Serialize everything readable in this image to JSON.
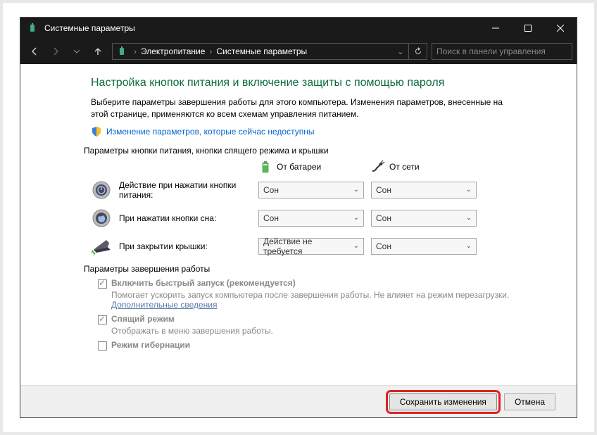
{
  "window": {
    "title": "Системные параметры"
  },
  "nav": {
    "crumb1": "Электропитание",
    "crumb2": "Системные параметры",
    "search_placeholder": "Поиск в панели управления"
  },
  "main": {
    "heading": "Настройка кнопок питания и включение защиты с помощью пароля",
    "desc": "Выберите параметры завершения работы для этого компьютера. Изменения параметров, внесенные на этой странице, применяются ко всем схемам управления питанием.",
    "unlock_link": "Изменение параметров, которые сейчас недоступны",
    "section1": "Параметры кнопки питания, кнопки спящего режима и крышки",
    "col_battery": "От батареи",
    "col_ac": "От сети",
    "rows": [
      {
        "label": "Действие при нажатии кнопки питания:",
        "battery": "Сон",
        "ac": "Сон"
      },
      {
        "label": "При нажатии кнопки сна:",
        "battery": "Сон",
        "ac": "Сон"
      },
      {
        "label": "При закрытии крышки:",
        "battery": "Действие не требуется",
        "ac": "Сон"
      }
    ],
    "section2": "Параметры завершения работы",
    "fastboot": {
      "label": "Включить быстрый запуск (рекомендуется)",
      "sub": "Помогает ускорить запуск компьютера после завершения работы. Не влияет на режим перезагрузки. ",
      "link": "Дополнительные сведения"
    },
    "sleep": {
      "label": "Спящий режим",
      "sub": "Отображать в меню завершения работы."
    },
    "hibernate": {
      "label": "Режим гибернации"
    }
  },
  "footer": {
    "save": "Сохранить изменения",
    "cancel": "Отмена"
  }
}
